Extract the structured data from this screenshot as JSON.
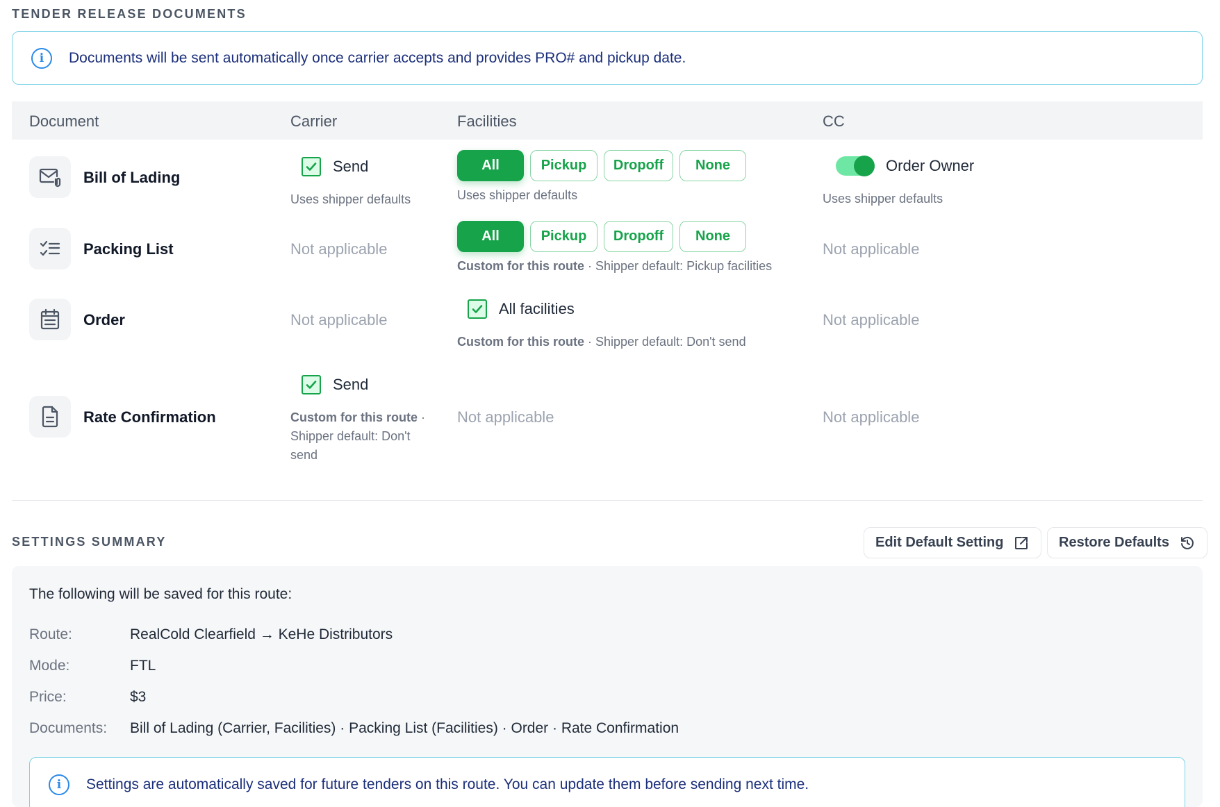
{
  "tender": {
    "title": "TENDER RELEASE DOCUMENTS",
    "banner": "Documents will be sent automatically once carrier accepts and provides PRO# and pickup date."
  },
  "columns": {
    "document": "Document",
    "carrier": "Carrier",
    "facilities": "Facilities",
    "cc": "CC"
  },
  "facility_options": [
    "All",
    "Pickup",
    "Dropoff",
    "None"
  ],
  "rows": {
    "bol": {
      "name": "Bill of Lading",
      "icon": "mail-attachment-icon",
      "carrier_label": "Send",
      "carrier_checked": true,
      "carrier_hint": "Uses shipper defaults",
      "facilities_selected": "All",
      "facilities_hint": "Uses shipper defaults",
      "cc_label": "Order Owner",
      "cc_on": true,
      "cc_hint": "Uses shipper defaults"
    },
    "packing": {
      "name": "Packing List",
      "icon": "checklist-icon",
      "carrier_na": "Not applicable",
      "facilities_selected": "All",
      "facilities_hint_bold": "Custom for this route",
      "facilities_hint_rest": " · Shipper default: Pickup facilities",
      "cc_na": "Not applicable"
    },
    "order": {
      "name": "Order",
      "icon": "calendar-list-icon",
      "carrier_na": "Not applicable",
      "facilities_label": "All facilities",
      "facilities_checked": true,
      "facilities_hint_bold": "Custom for this route",
      "facilities_hint_rest": " · Shipper default: Don't send",
      "cc_na": "Not applicable"
    },
    "rate": {
      "name": "Rate Confirmation",
      "icon": "document-icon",
      "carrier_label": "Send",
      "carrier_checked": true,
      "carrier_hint_bold": "Custom for this route",
      "carrier_hint_l1_rest": " ·",
      "carrier_hint_l2": "Shipper default: Don't",
      "carrier_hint_l3": "send",
      "facilities_na": "Not applicable",
      "cc_na": "Not applicable"
    }
  },
  "summary": {
    "title": "SETTINGS SUMMARY",
    "edit_button": "Edit Default Setting",
    "restore_button": "Restore Defaults",
    "intro": "The following will be saved for this route:",
    "route_label": "Route:",
    "route_value": "RealCold Clearfield → KeHe Distributors",
    "mode_label": "Mode:",
    "mode_value": "FTL",
    "price_label": "Price:",
    "price_value": "$3",
    "documents_label": "Documents:",
    "documents_value": "Bill of Lading (Carrier, Facilities) · Packing List (Facilities) · Order · Rate Confirmation",
    "banner": "Settings are automatically saved for future tenders on this route. You can update them before sending next time."
  },
  "colors": {
    "accent_green": "#16a34a",
    "info_blue": "#2b8ae8",
    "info_text": "#1b2f7a",
    "banner_border": "#7dd3e8"
  }
}
